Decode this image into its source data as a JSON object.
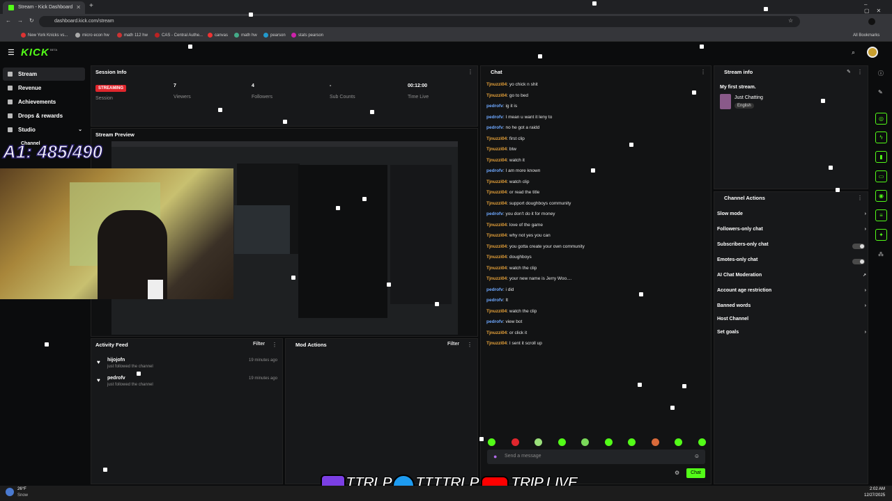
{
  "browser": {
    "tab_title": "Stream - Kick Dashboard",
    "url": "dashboard.kick.com/stream",
    "bookmarks": [
      "New York Knicks vs...",
      "micro econ hw",
      "math 112 hw",
      "CAS - Central Authe...",
      "canvas",
      "math hw",
      "pearson",
      "stats pearson"
    ],
    "all_bookmarks": "All Bookmarks"
  },
  "app": {
    "logo": "KICK",
    "beta": "BETA"
  },
  "sidebar": {
    "items": [
      "Stream",
      "Revenue",
      "Achievements",
      "Drops & rewards",
      "Studio",
      "Channel"
    ]
  },
  "session": {
    "title": "Session Info",
    "badge": "STREAMING",
    "session_label": "Session",
    "viewers": "7",
    "viewers_label": "Viewers",
    "followers": "4",
    "followers_label": "Followers",
    "subs": "-",
    "subs_label": "Sub Counts",
    "time": "00:12:00",
    "time_label": "Time Live"
  },
  "preview": {
    "title": "Stream Preview",
    "overlay": "A1: 485/490"
  },
  "activity": {
    "title": "Activity Feed",
    "filter": "Filter",
    "items": [
      {
        "user": "hijojofn",
        "action": "just followed the channel",
        "time": "19 minutes ago"
      },
      {
        "user": "pedrofv",
        "action": "just followed the channel",
        "time": "19 minutes ago"
      }
    ]
  },
  "mod": {
    "title": "Mod Actions",
    "filter": "Filter"
  },
  "chat": {
    "title": "Chat",
    "placeholder": "Send a message",
    "send": "Chat",
    "messages": [
      {
        "u": "Tjnuzzi04",
        "m": "yo chick n shit",
        "c": "#e8a33a"
      },
      {
        "u": "Tjnuzzi04",
        "m": "go to bed",
        "c": "#e8a33a"
      },
      {
        "u": "pedrofv",
        "m": "ig it is",
        "c": "#6ea8ff"
      },
      {
        "u": "pedrofv",
        "m": "I mean u want it leny to",
        "c": "#6ea8ff"
      },
      {
        "u": "pedrofv",
        "m": "no he got a raidd",
        "c": "#6ea8ff"
      },
      {
        "u": "Tjnuzzi04",
        "m": "first clip",
        "c": "#e8a33a"
      },
      {
        "u": "Tjnuzzi04",
        "m": "btw",
        "c": "#e8a33a"
      },
      {
        "u": "Tjnuzzi04",
        "m": "watch it",
        "c": "#e8a33a"
      },
      {
        "u": "pedrofv",
        "m": "I am more known",
        "c": "#6ea8ff"
      },
      {
        "u": "Tjnuzzi04",
        "m": "watch clip",
        "c": "#e8a33a"
      },
      {
        "u": "Tjnuzzi04",
        "m": "or read the title",
        "c": "#e8a33a"
      },
      {
        "u": "Tjnuzzi04",
        "m": "support doughboys community",
        "c": "#e8a33a"
      },
      {
        "u": "pedrofv",
        "m": "you don't do it for money",
        "c": "#6ea8ff"
      },
      {
        "u": "Tjnuzzi04",
        "m": "love of the game",
        "c": "#e8a33a"
      },
      {
        "u": "Tjnuzzi04",
        "m": "why not yes you can",
        "c": "#e8a33a"
      },
      {
        "u": "Tjnuzzi04",
        "m": "you gotta create your own community",
        "c": "#e8a33a"
      },
      {
        "u": "Tjnuzzi04",
        "m": "doughboys",
        "c": "#e8a33a"
      },
      {
        "u": "Tjnuzzi04",
        "m": "watch the clip",
        "c": "#e8a33a"
      },
      {
        "u": "Tjnuzzi04",
        "m": "your new name is Jerry Woo....",
        "c": "#e8a33a"
      },
      {
        "u": "pedrofv",
        "m": "i did",
        "c": "#6ea8ff"
      },
      {
        "u": "pedrofv",
        "m": "It",
        "c": "#6ea8ff"
      },
      {
        "u": "Tjnuzzi04",
        "m": "watch the clip",
        "c": "#e8a33a"
      },
      {
        "u": "pedrofv",
        "m": "view bot",
        "c": "#6ea8ff"
      },
      {
        "u": "Tjnuzzi04",
        "m": "or click it",
        "c": "#e8a33a"
      },
      {
        "u": "Tjnuzzi04",
        "m": "I sent it scroll up",
        "c": "#e8a33a"
      }
    ]
  },
  "stream_info": {
    "title": "Stream info",
    "stream_title": "My first stream.",
    "category": "Just Chatting",
    "language": "English"
  },
  "channel_actions": {
    "title": "Channel Actions",
    "items": [
      "Slow mode",
      "Followers-only chat",
      "Subscribers-only chat",
      "Emotes-only chat",
      "AI Chat Moderation",
      "Account age restriction",
      "Banned words",
      "Host Channel",
      "Set goals"
    ]
  },
  "overlay": {
    "twitch": "TTRLP",
    "twitter": "TTTTRLP",
    "youtube": "TRIP LIVE"
  },
  "taskbar": {
    "temp": "26°F",
    "weather": "Snow",
    "time": "2:02 AM",
    "date": "12/27/2025"
  },
  "colors": {
    "accent": "#53fc18",
    "streaming": "#e0262d",
    "panel": "#17181a"
  }
}
